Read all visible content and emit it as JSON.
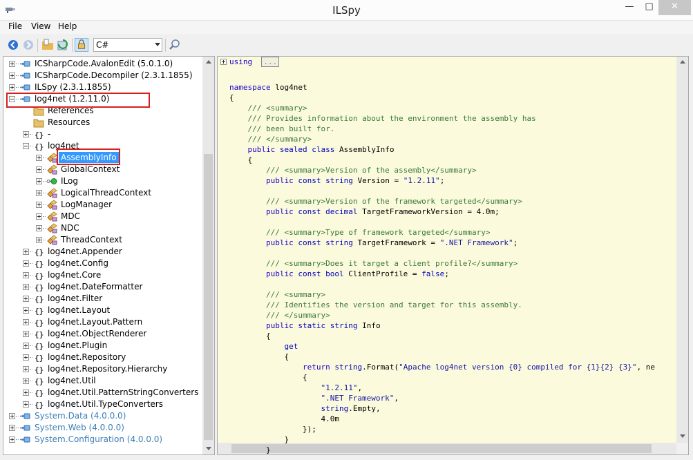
{
  "window": {
    "title": "ILSpy"
  },
  "menu": [
    {
      "label": "File"
    },
    {
      "label": "View"
    },
    {
      "label": "Help"
    }
  ],
  "toolbar": {
    "language": "C#"
  },
  "tree": {
    "items": [
      {
        "label": "ICSharpCode.AvalonEdit (5.0.1.0)",
        "icon": "assembly-icon",
        "expander": "plus",
        "indent": 0,
        "style": "normal"
      },
      {
        "label": "ICSharpCode.Decompiler (2.3.1.1855)",
        "icon": "assembly-icon",
        "expander": "plus",
        "indent": 0,
        "style": "normal"
      },
      {
        "label": "ILSpy (2.3.1.1855)",
        "icon": "assembly-icon",
        "expander": "plus",
        "indent": 0,
        "style": "normal"
      },
      {
        "label": "log4net (1.2.11.0)",
        "icon": "assembly-icon",
        "expander": "minus",
        "indent": 0,
        "style": "normal"
      },
      {
        "label": "References",
        "icon": "folder-icon",
        "expander": "none",
        "indent": 1,
        "style": "normal"
      },
      {
        "label": "Resources",
        "icon": "folder-icon",
        "expander": "none",
        "indent": 1,
        "style": "normal"
      },
      {
        "label": "-",
        "icon": "namespace-icon",
        "expander": "plus",
        "indent": 1,
        "style": "normal"
      },
      {
        "label": "log4net",
        "icon": "namespace-icon",
        "expander": "minus",
        "indent": 1,
        "style": "normal"
      },
      {
        "label": "AssemblyInfo",
        "icon": "class-icon",
        "expander": "plus",
        "indent": 2,
        "style": "selected"
      },
      {
        "label": "GlobalContext",
        "icon": "class-icon",
        "expander": "plus",
        "indent": 2,
        "style": "normal"
      },
      {
        "label": "ILog",
        "icon": "interface-icon",
        "expander": "plus",
        "indent": 2,
        "style": "normal"
      },
      {
        "label": "LogicalThreadContext",
        "icon": "class-icon",
        "expander": "plus",
        "indent": 2,
        "style": "normal"
      },
      {
        "label": "LogManager",
        "icon": "class-icon",
        "expander": "plus",
        "indent": 2,
        "style": "normal"
      },
      {
        "label": "MDC",
        "icon": "class-icon",
        "expander": "plus",
        "indent": 2,
        "style": "normal"
      },
      {
        "label": "NDC",
        "icon": "class-icon",
        "expander": "plus",
        "indent": 2,
        "style": "normal"
      },
      {
        "label": "ThreadContext",
        "icon": "class-icon",
        "expander": "plus",
        "indent": 2,
        "style": "normal"
      },
      {
        "label": "log4net.Appender",
        "icon": "namespace-icon",
        "expander": "plus",
        "indent": 1,
        "style": "normal"
      },
      {
        "label": "log4net.Config",
        "icon": "namespace-icon",
        "expander": "plus",
        "indent": 1,
        "style": "normal"
      },
      {
        "label": "log4net.Core",
        "icon": "namespace-icon",
        "expander": "plus",
        "indent": 1,
        "style": "normal"
      },
      {
        "label": "log4net.DateFormatter",
        "icon": "namespace-icon",
        "expander": "plus",
        "indent": 1,
        "style": "normal"
      },
      {
        "label": "log4net.Filter",
        "icon": "namespace-icon",
        "expander": "plus",
        "indent": 1,
        "style": "normal"
      },
      {
        "label": "log4net.Layout",
        "icon": "namespace-icon",
        "expander": "plus",
        "indent": 1,
        "style": "normal"
      },
      {
        "label": "log4net.Layout.Pattern",
        "icon": "namespace-icon",
        "expander": "plus",
        "indent": 1,
        "style": "normal"
      },
      {
        "label": "log4net.ObjectRenderer",
        "icon": "namespace-icon",
        "expander": "plus",
        "indent": 1,
        "style": "normal"
      },
      {
        "label": "log4net.Plugin",
        "icon": "namespace-icon",
        "expander": "plus",
        "indent": 1,
        "style": "normal"
      },
      {
        "label": "log4net.Repository",
        "icon": "namespace-icon",
        "expander": "plus",
        "indent": 1,
        "style": "normal"
      },
      {
        "label": "log4net.Repository.Hierarchy",
        "icon": "namespace-icon",
        "expander": "plus",
        "indent": 1,
        "style": "normal"
      },
      {
        "label": "log4net.Util",
        "icon": "namespace-icon",
        "expander": "plus",
        "indent": 1,
        "style": "normal"
      },
      {
        "label": "log4net.Util.PatternStringConverters",
        "icon": "namespace-icon",
        "expander": "plus",
        "indent": 1,
        "style": "normal"
      },
      {
        "label": "log4net.Util.TypeConverters",
        "icon": "namespace-icon",
        "expander": "plus",
        "indent": 1,
        "style": "normal"
      },
      {
        "label": "System.Data (4.0.0.0)",
        "icon": "assembly-icon",
        "expander": "plus",
        "indent": 0,
        "style": "blue"
      },
      {
        "label": "System.Web (4.0.0.0)",
        "icon": "assembly-icon",
        "expander": "plus",
        "indent": 0,
        "style": "blue"
      },
      {
        "label": "System.Configuration (4.0.0.0)",
        "icon": "assembly-icon",
        "expander": "plus",
        "indent": 0,
        "style": "blue"
      }
    ]
  },
  "code": {
    "lines": [
      [
        [
          "kw",
          "using"
        ],
        [
          "",
          "  "
        ],
        [
          "cm",
          "..."
        ]
      ],
      [],
      [
        [
          "kw",
          "namespace"
        ],
        [
          "",
          " log4net"
        ]
      ],
      [
        [
          "",
          "{"
        ]
      ],
      [
        [
          "",
          "    "
        ],
        [
          "cmt",
          "/// <summary>"
        ]
      ],
      [
        [
          "",
          "    "
        ],
        [
          "cmt",
          "/// Provides information about the environment the assembly has"
        ]
      ],
      [
        [
          "",
          "    "
        ],
        [
          "cmt",
          "/// been built for."
        ]
      ],
      [
        [
          "",
          "    "
        ],
        [
          "cmt",
          "/// </summary>"
        ]
      ],
      [
        [
          "",
          "    "
        ],
        [
          "kw",
          "public"
        ],
        [
          "",
          " "
        ],
        [
          "kw2",
          "sealed class"
        ],
        [
          "",
          " AssemblyInfo"
        ]
      ],
      [
        [
          "",
          "    {"
        ]
      ],
      [
        [
          "",
          "        "
        ],
        [
          "cmt",
          "/// <summary>"
        ],
        [
          "cmt",
          "Version of the assembly"
        ],
        [
          "cmt",
          "</summary>"
        ]
      ],
      [
        [
          "",
          "        "
        ],
        [
          "kw",
          "public"
        ],
        [
          "",
          " "
        ],
        [
          "kw2",
          "const string"
        ],
        [
          "",
          " Version = "
        ],
        [
          "str",
          "\"1.2.11\""
        ],
        [
          "",
          ";"
        ]
      ],
      [],
      [
        [
          "",
          "        "
        ],
        [
          "cmt",
          "/// <summary>"
        ],
        [
          "cmt",
          "Version of the framework targeted"
        ],
        [
          "cmt",
          "</summary>"
        ]
      ],
      [
        [
          "",
          "        "
        ],
        [
          "kw",
          "public"
        ],
        [
          "",
          " "
        ],
        [
          "kw2",
          "const decimal"
        ],
        [
          "",
          " TargetFrameworkVersion = 4.0m;"
        ]
      ],
      [],
      [
        [
          "",
          "        "
        ],
        [
          "cmt",
          "/// <summary>"
        ],
        [
          "cmt",
          "Type of framework targeted"
        ],
        [
          "cmt",
          "</summary>"
        ]
      ],
      [
        [
          "",
          "        "
        ],
        [
          "kw",
          "public"
        ],
        [
          "",
          " "
        ],
        [
          "kw2",
          "const string"
        ],
        [
          "",
          " TargetFramework = "
        ],
        [
          "str",
          "\".NET Framework\""
        ],
        [
          "",
          ";"
        ]
      ],
      [],
      [
        [
          "",
          "        "
        ],
        [
          "cmt",
          "/// <summary>"
        ],
        [
          "cmt",
          "Does it target a client profile?"
        ],
        [
          "cmt",
          "</summary>"
        ]
      ],
      [
        [
          "",
          "        "
        ],
        [
          "kw",
          "public"
        ],
        [
          "",
          " "
        ],
        [
          "kw2",
          "const bool"
        ],
        [
          "",
          " ClientProfile = "
        ],
        [
          "kw2",
          "false"
        ],
        [
          "",
          ";"
        ]
      ],
      [],
      [
        [
          "",
          "        "
        ],
        [
          "cmt",
          "/// <summary>"
        ]
      ],
      [
        [
          "",
          "        "
        ],
        [
          "cmt",
          "/// Identifies the version and target for this assembly."
        ]
      ],
      [
        [
          "",
          "        "
        ],
        [
          "cmt",
          "/// </summary>"
        ]
      ],
      [
        [
          "",
          "        "
        ],
        [
          "kw",
          "public"
        ],
        [
          "",
          " "
        ],
        [
          "kw2",
          "static string"
        ],
        [
          "",
          " Info"
        ]
      ],
      [
        [
          "",
          "        {"
        ]
      ],
      [
        [
          "",
          "            "
        ],
        [
          "kw2",
          "get"
        ]
      ],
      [
        [
          "",
          "            {"
        ]
      ],
      [
        [
          "",
          "                "
        ],
        [
          "kw",
          "return"
        ],
        [
          "",
          " "
        ],
        [
          "kw2",
          "string"
        ],
        [
          "",
          ".Format("
        ],
        [
          "str",
          "\"Apache log4net version {0} compiled for {1}{2} {3}\""
        ],
        [
          "",
          ", ne"
        ]
      ],
      [
        [
          "",
          "                {"
        ]
      ],
      [
        [
          "",
          "                    "
        ],
        [
          "str",
          "\"1.2.11\""
        ],
        [
          "",
          ","
        ]
      ],
      [
        [
          "",
          "                    "
        ],
        [
          "str",
          "\".NET Framework\""
        ],
        [
          "",
          ","
        ]
      ],
      [
        [
          "",
          "                    "
        ],
        [
          "kw2",
          "string"
        ],
        [
          "",
          ".Empty,"
        ]
      ],
      [
        [
          "",
          "                    4.0m"
        ]
      ],
      [
        [
          "",
          "                });"
        ]
      ],
      [
        [
          "",
          "            }"
        ]
      ],
      [
        [
          "",
          "        }"
        ]
      ]
    ]
  }
}
